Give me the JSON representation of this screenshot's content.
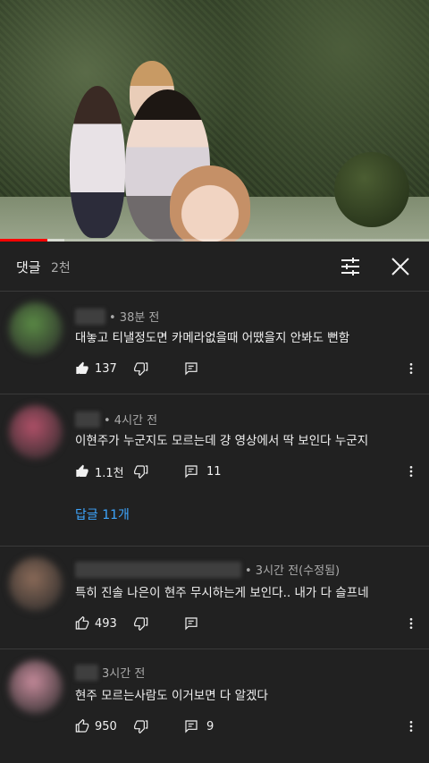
{
  "video": {
    "progress": 0.11,
    "buffered": 0.15
  },
  "header": {
    "title": "댓글",
    "count": "2천"
  },
  "comments": [
    {
      "time": "• 38분 전",
      "text": "대놓고 티낼정도면 카메라없을때 어땠을지 안봐도 뻔함",
      "likes": "137",
      "replies": "",
      "avatar_color": "#5a8a45"
    },
    {
      "time": "• 4시간 전",
      "text": "이현주가 누군지도 모르는데 걍 영상에서 딱 보인다 누군지",
      "likes": "1.1천",
      "replies": "11",
      "replies_link": "답글 11개",
      "avatar_color": "#b05068"
    },
    {
      "time": "• 3시간 전(수정됨)",
      "text": "특히 진솔 나은이 현주 무시하는게 보인다.. 내가 다 슬프네",
      "likes": "493",
      "replies": "",
      "avatar_color": "#8a6a58"
    },
    {
      "time": "3시간 전",
      "text": "현주 모르는사람도 이거보면 다 알겠다",
      "likes": "950",
      "replies": "9",
      "avatar_color": "#c58a9a"
    }
  ],
  "colors": {
    "background": "#212121",
    "accent": "#ff0000",
    "link": "#3ea6ff"
  },
  "icons": [
    "filter-icon",
    "close-icon",
    "thumbs-up-icon",
    "thumbs-down-icon",
    "reply-icon",
    "more-vert-icon"
  ]
}
